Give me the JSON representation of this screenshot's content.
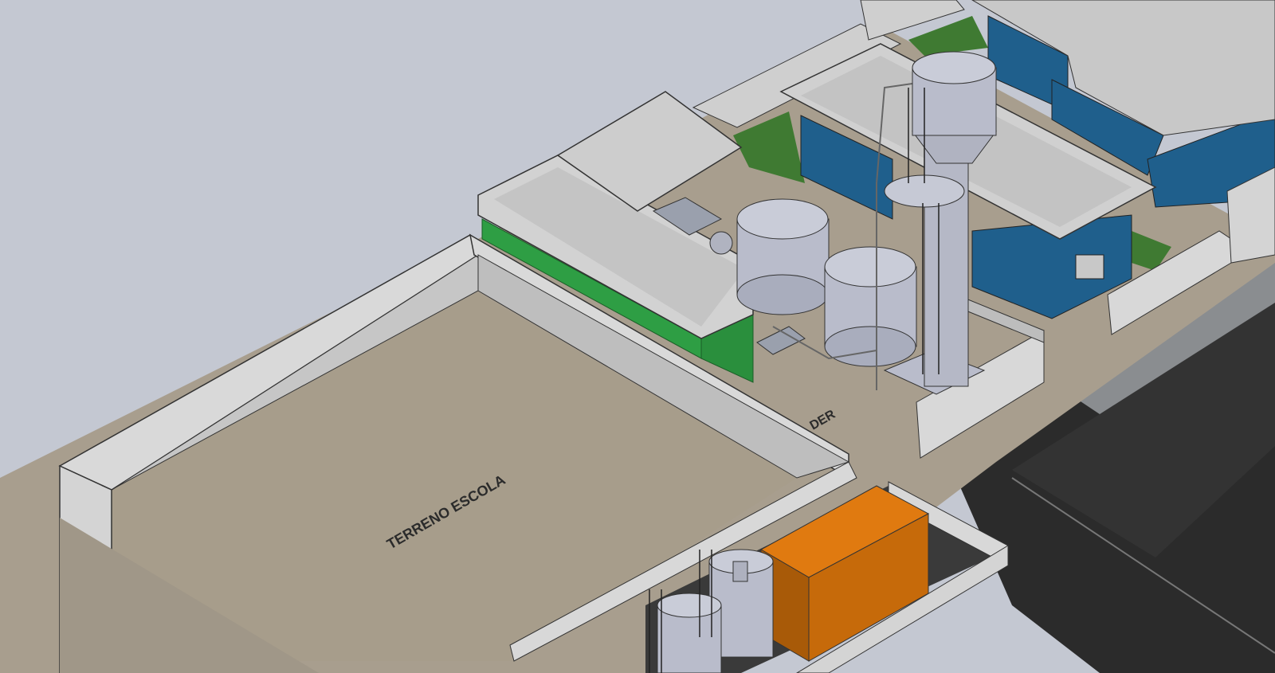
{
  "scene": {
    "terrain_label": "TERRENO ESCOLA",
    "partial_label": "DER"
  },
  "colors": {
    "background": "#c4c8d2",
    "ground": "#a59b8c",
    "wall": "#d6d6d6",
    "green_building": "#2e9e44",
    "blue_building": "#1f5f8c",
    "tank": "#b9bccb",
    "container": "#d9720a",
    "asphalt": "#2a2a2a",
    "grass": "#3f7a32"
  }
}
